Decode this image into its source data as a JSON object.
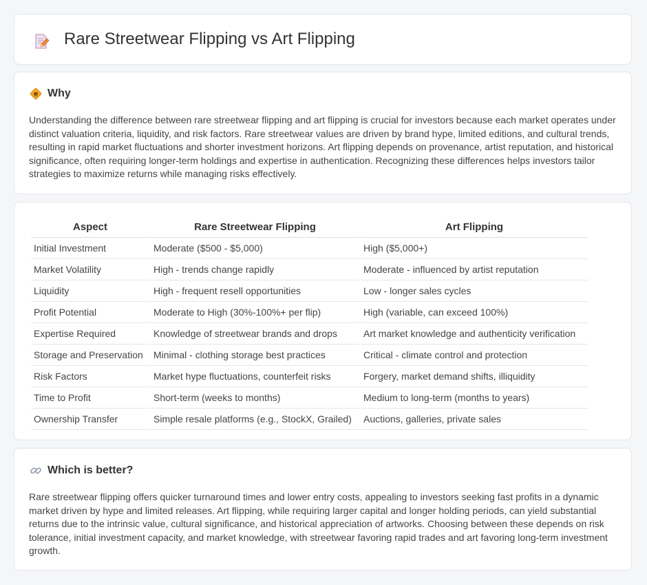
{
  "page": {
    "title": "Rare Streetwear Flipping vs Art Flipping"
  },
  "icons": {
    "title": "document-pencil-icon",
    "why": "diamond-sign-icon",
    "better": "link-icon"
  },
  "why": {
    "heading": "Why",
    "text": "Understanding the difference between rare streetwear flipping and art flipping is crucial for investors because each market operates under distinct valuation criteria, liquidity, and risk factors. Rare streetwear values are driven by brand hype, limited editions, and cultural trends, resulting in rapid market fluctuations and shorter investment horizons. Art flipping depends on provenance, artist reputation, and historical significance, often requiring longer-term holdings and expertise in authentication. Recognizing these differences helps investors tailor strategies to maximize returns while managing risks effectively."
  },
  "table": {
    "headers": [
      "Aspect",
      "Rare Streetwear Flipping",
      "Art Flipping"
    ],
    "rows": [
      [
        "Initial Investment",
        "Moderate ($500 - $5,000)",
        "High ($5,000+)"
      ],
      [
        "Market Volatility",
        "High - trends change rapidly",
        "Moderate - influenced by artist reputation"
      ],
      [
        "Liquidity",
        "High - frequent resell opportunities",
        "Low - longer sales cycles"
      ],
      [
        "Profit Potential",
        "Moderate to High (30%-100%+ per flip)",
        "High (variable, can exceed 100%)"
      ],
      [
        "Expertise Required",
        "Knowledge of streetwear brands and drops",
        "Art market knowledge and authenticity verification"
      ],
      [
        "Storage and Preservation",
        "Minimal - clothing storage best practices",
        "Critical - climate control and protection"
      ],
      [
        "Risk Factors",
        "Market hype fluctuations, counterfeit risks",
        "Forgery, market demand shifts, illiquidity"
      ],
      [
        "Time to Profit",
        "Short-term (weeks to months)",
        "Medium to long-term (months to years)"
      ],
      [
        "Ownership Transfer",
        "Simple resale platforms (e.g., StockX, Grailed)",
        "Auctions, galleries, private sales"
      ]
    ]
  },
  "better": {
    "heading": "Which is better?",
    "text": "Rare streetwear flipping offers quicker turnaround times and lower entry costs, appealing to investors seeking fast profits in a dynamic market driven by hype and limited releases. Art flipping, while requiring larger capital and longer holding periods, can yield substantial returns due to the intrinsic value, cultural significance, and historical appreciation of artworks. Choosing between these depends on risk tolerance, initial investment capacity, and market knowledge, with streetwear favoring rapid trades and art favoring long-term investment growth."
  }
}
